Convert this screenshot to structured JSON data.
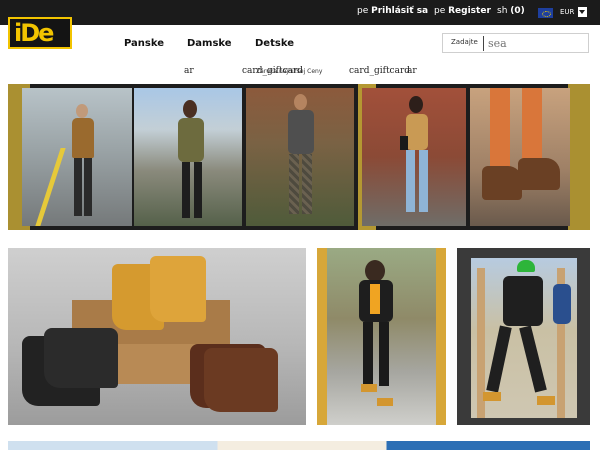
{
  "topbar": {
    "item1_fragment": "pe",
    "login_label": "Prihlásiť sa",
    "item2_fragment": "pe",
    "register_label": "Register",
    "cart_fragment": "sh",
    "cart_count": "(0)",
    "currency": "EUR"
  },
  "logo_text": "iDe",
  "nav": {
    "items": [
      "Panske",
      "Damske",
      "Detske"
    ]
  },
  "search": {
    "label": "Zadajte",
    "placeholder": "sea"
  },
  "alt_row": {
    "alt1": "ar",
    "alt2": "card_giftcard",
    "alt3": "Záruka najnižšej Ceny",
    "alt4": "card_giftcard",
    "alt5": "ar"
  },
  "colors": {
    "topbar": "#1b1b1b",
    "accent_yellow": "#f2c400",
    "text": "#111111"
  }
}
